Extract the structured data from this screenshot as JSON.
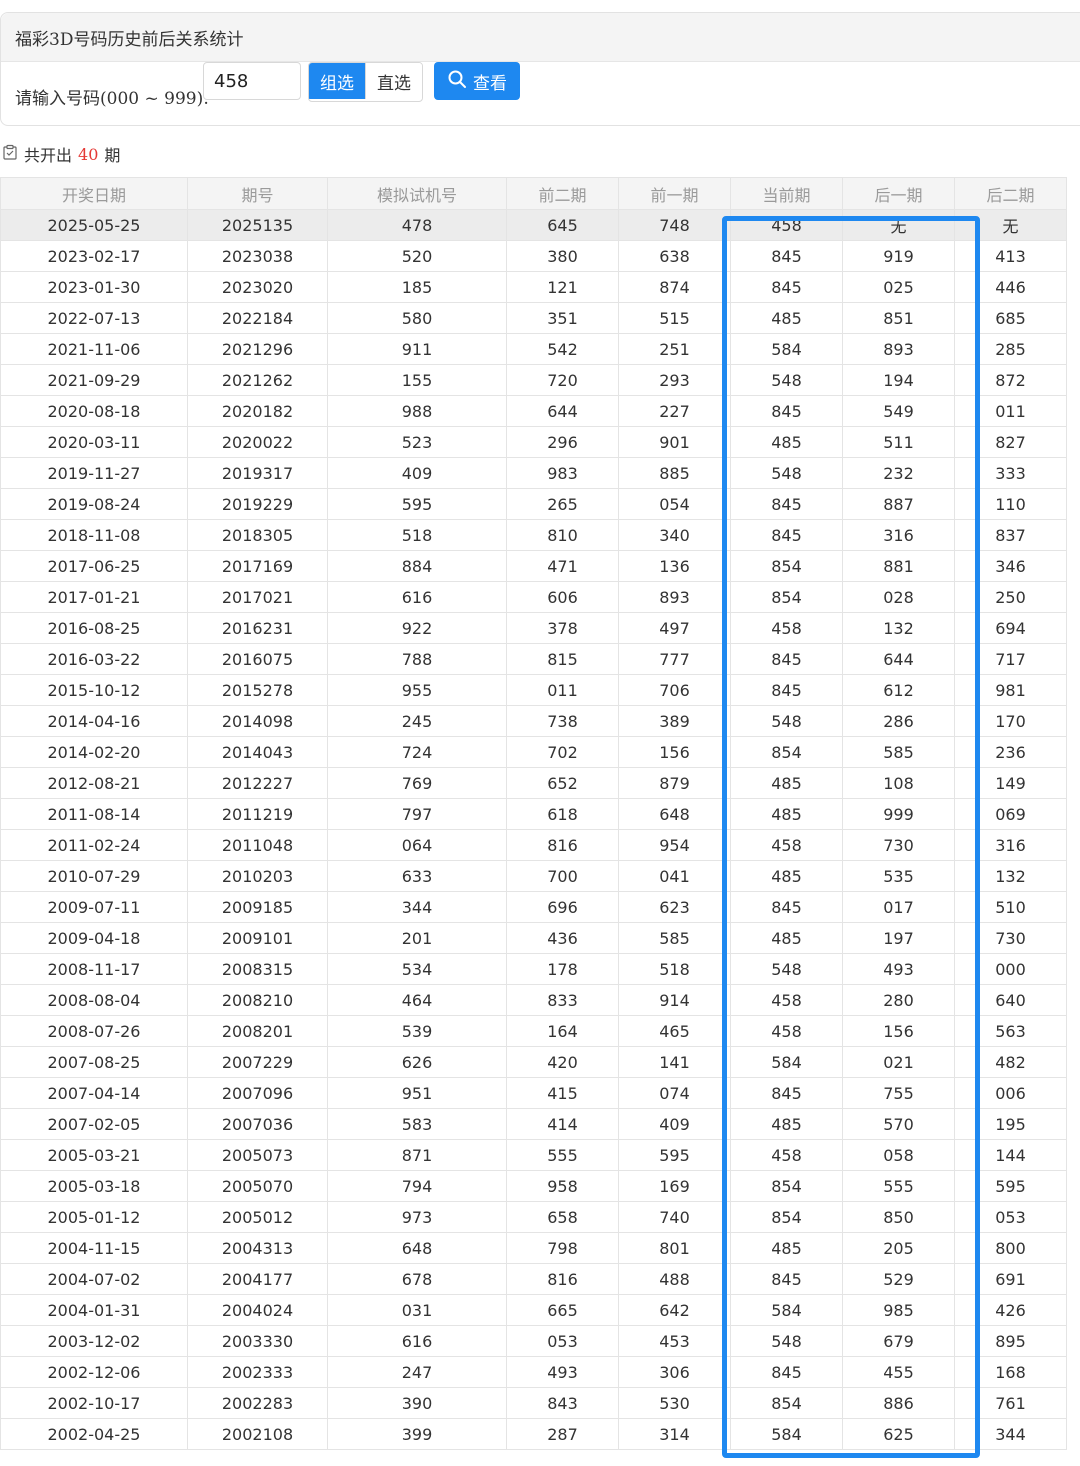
{
  "panel": {
    "title": "福彩3D号码历史前后关系统计",
    "input_label": "请输入号码(000 ~ 999):",
    "input_value": "458",
    "mode_group": "组选",
    "mode_direct": "直选",
    "search_label": "查看"
  },
  "summary": {
    "prefix": "共开出",
    "count": "40",
    "suffix": "期"
  },
  "table": {
    "headers": [
      "开奖日期",
      "期号",
      "模拟试机号",
      "前二期",
      "前一期",
      "当前期",
      "后一期",
      "后二期"
    ],
    "rows": [
      [
        "2025-05-25",
        "2025135",
        "478",
        "645",
        "748",
        "458",
        "无",
        "无"
      ],
      [
        "2023-02-17",
        "2023038",
        "520",
        "380",
        "638",
        "845",
        "919",
        "413"
      ],
      [
        "2023-01-30",
        "2023020",
        "185",
        "121",
        "874",
        "845",
        "025",
        "446"
      ],
      [
        "2022-07-13",
        "2022184",
        "580",
        "351",
        "515",
        "485",
        "851",
        "685"
      ],
      [
        "2021-11-06",
        "2021296",
        "911",
        "542",
        "251",
        "584",
        "893",
        "285"
      ],
      [
        "2021-09-29",
        "2021262",
        "155",
        "720",
        "293",
        "548",
        "194",
        "872"
      ],
      [
        "2020-08-18",
        "2020182",
        "988",
        "644",
        "227",
        "845",
        "549",
        "011"
      ],
      [
        "2020-03-11",
        "2020022",
        "523",
        "296",
        "901",
        "485",
        "511",
        "827"
      ],
      [
        "2019-11-27",
        "2019317",
        "409",
        "983",
        "885",
        "548",
        "232",
        "333"
      ],
      [
        "2019-08-24",
        "2019229",
        "595",
        "265",
        "054",
        "845",
        "887",
        "110"
      ],
      [
        "2018-11-08",
        "2018305",
        "518",
        "810",
        "340",
        "845",
        "316",
        "837"
      ],
      [
        "2017-06-25",
        "2017169",
        "884",
        "471",
        "136",
        "854",
        "881",
        "346"
      ],
      [
        "2017-01-21",
        "2017021",
        "616",
        "606",
        "893",
        "854",
        "028",
        "250"
      ],
      [
        "2016-08-25",
        "2016231",
        "922",
        "378",
        "497",
        "458",
        "132",
        "694"
      ],
      [
        "2016-03-22",
        "2016075",
        "788",
        "815",
        "777",
        "845",
        "644",
        "717"
      ],
      [
        "2015-10-12",
        "2015278",
        "955",
        "011",
        "706",
        "845",
        "612",
        "981"
      ],
      [
        "2014-04-16",
        "2014098",
        "245",
        "738",
        "389",
        "548",
        "286",
        "170"
      ],
      [
        "2014-02-20",
        "2014043",
        "724",
        "702",
        "156",
        "854",
        "585",
        "236"
      ],
      [
        "2012-08-21",
        "2012227",
        "769",
        "652",
        "879",
        "485",
        "108",
        "149"
      ],
      [
        "2011-08-14",
        "2011219",
        "797",
        "618",
        "648",
        "485",
        "999",
        "069"
      ],
      [
        "2011-02-24",
        "2011048",
        "064",
        "816",
        "954",
        "458",
        "730",
        "316"
      ],
      [
        "2010-07-29",
        "2010203",
        "633",
        "700",
        "041",
        "485",
        "535",
        "132"
      ],
      [
        "2009-07-11",
        "2009185",
        "344",
        "696",
        "623",
        "845",
        "017",
        "510"
      ],
      [
        "2009-04-18",
        "2009101",
        "201",
        "436",
        "585",
        "485",
        "197",
        "730"
      ],
      [
        "2008-11-17",
        "2008315",
        "534",
        "178",
        "518",
        "548",
        "493",
        "000"
      ],
      [
        "2008-08-04",
        "2008210",
        "464",
        "833",
        "914",
        "458",
        "280",
        "640"
      ],
      [
        "2008-07-26",
        "2008201",
        "539",
        "164",
        "465",
        "458",
        "156",
        "563"
      ],
      [
        "2007-08-25",
        "2007229",
        "626",
        "420",
        "141",
        "584",
        "021",
        "482"
      ],
      [
        "2007-04-14",
        "2007096",
        "951",
        "415",
        "074",
        "845",
        "755",
        "006"
      ],
      [
        "2007-02-05",
        "2007036",
        "583",
        "414",
        "409",
        "485",
        "570",
        "195"
      ],
      [
        "2005-03-21",
        "2005073",
        "871",
        "555",
        "595",
        "458",
        "058",
        "144"
      ],
      [
        "2005-03-18",
        "2005070",
        "794",
        "958",
        "169",
        "854",
        "555",
        "595"
      ],
      [
        "2005-01-12",
        "2005012",
        "973",
        "658",
        "740",
        "854",
        "850",
        "053"
      ],
      [
        "2004-11-15",
        "2004313",
        "648",
        "798",
        "801",
        "485",
        "205",
        "800"
      ],
      [
        "2004-07-02",
        "2004177",
        "678",
        "816",
        "488",
        "845",
        "529",
        "691"
      ],
      [
        "2004-01-31",
        "2004024",
        "031",
        "665",
        "642",
        "584",
        "985",
        "426"
      ],
      [
        "2003-12-02",
        "2003330",
        "616",
        "053",
        "453",
        "548",
        "679",
        "895"
      ],
      [
        "2002-12-06",
        "2002333",
        "247",
        "493",
        "306",
        "845",
        "455",
        "168"
      ],
      [
        "2002-10-17",
        "2002283",
        "390",
        "843",
        "530",
        "854",
        "886",
        "761"
      ],
      [
        "2002-04-25",
        "2002108",
        "399",
        "287",
        "314",
        "584",
        "625",
        "344"
      ]
    ]
  },
  "colors": {
    "accent": "#1e88f0",
    "count": "#e53935",
    "header_bg": "#f4f4f4"
  }
}
